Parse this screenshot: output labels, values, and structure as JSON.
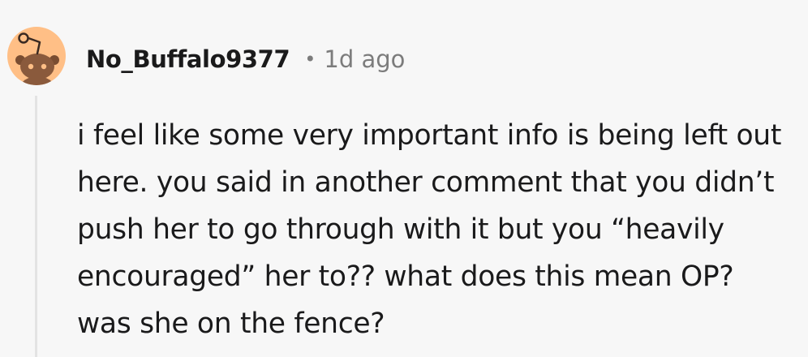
{
  "comment": {
    "username": "No_Buffalo9377",
    "separator": "•",
    "timestamp": "1d ago",
    "body": "i feel like some very important info is being left out here. you said in another comment that you didn’t push her to go through with it but you “heavily encouraged” her to?? what does this mean OP? was she on the fence?"
  },
  "avatar": {
    "icon": "snoo-avatar-icon",
    "background_color": "#ffbf86",
    "figure_color": "#8a5a3c"
  }
}
